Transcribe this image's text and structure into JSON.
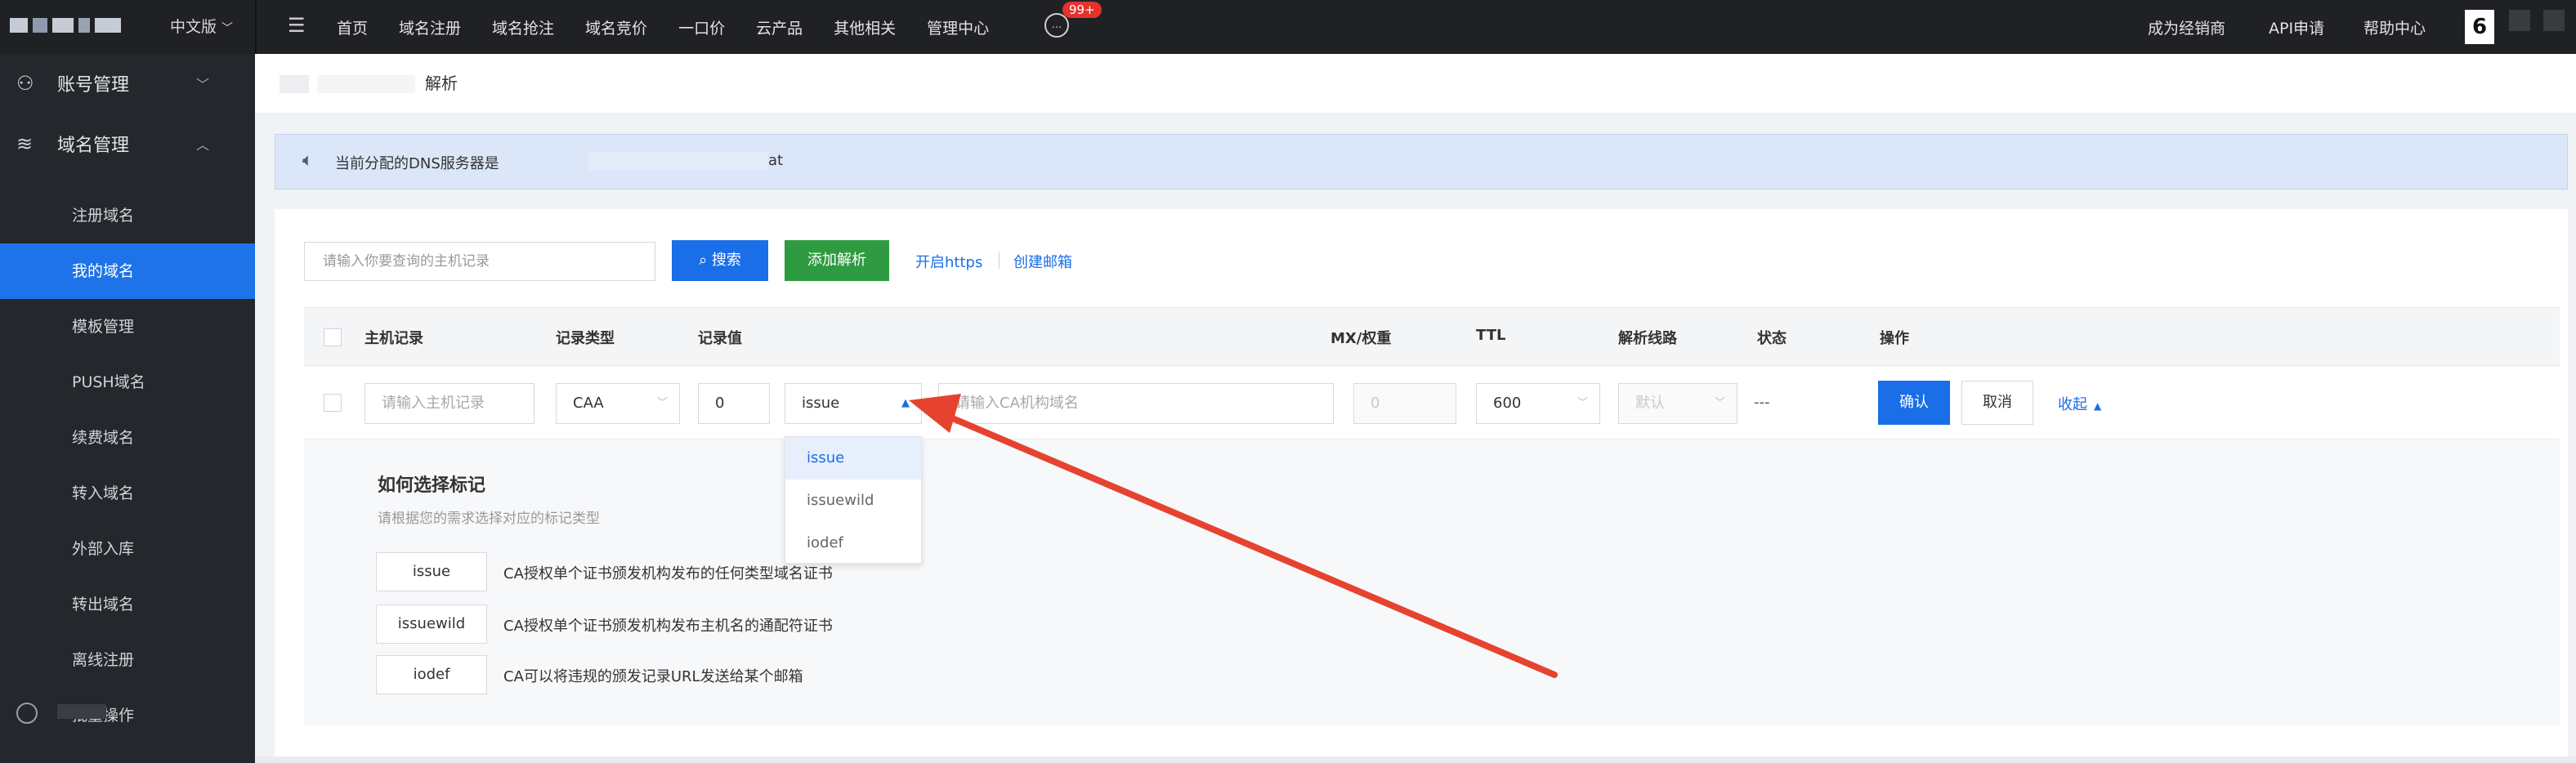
{
  "topbar": {
    "lang": "中文版",
    "nav": [
      "首页",
      "域名注册",
      "域名抢注",
      "域名竞价",
      "一口价",
      "云产品",
      "其他相关",
      "管理中心"
    ],
    "badge": "99+",
    "right_nav": [
      "成为经销商",
      "API申请",
      "帮助中心"
    ],
    "avatar_text": "6"
  },
  "sidebar": {
    "group_account": "账号管理",
    "group_domain": "域名管理",
    "items": [
      "注册域名",
      "我的域名",
      "模板管理",
      "PUSH域名",
      "续费域名",
      "转入域名",
      "外部入库",
      "转出域名",
      "离线注册",
      "批量操作"
    ],
    "active_index": 1
  },
  "breadcrumb": {
    "title": "解析"
  },
  "dns_notice": {
    "text": "当前分配的DNS服务器是",
    "tail": "at"
  },
  "toolbar": {
    "search_placeholder": "请输入你要查询的主机记录",
    "search_button": "搜索",
    "add_button": "添加解析",
    "link_https": "开启https",
    "link_email": "创建邮箱"
  },
  "table": {
    "headers": [
      "主机记录",
      "记录类型",
      "记录值",
      "MX/权重",
      "TTL",
      "解析线路",
      "状态",
      "操作"
    ],
    "row": {
      "host_placeholder": "请输入主机记录",
      "type": "CAA",
      "flag": "0",
      "tag": "issue",
      "value_placeholder": "请输入CA机构域名",
      "mx": "0",
      "ttl": "600",
      "line": "默认",
      "status": "---",
      "confirm": "确认",
      "cancel": "取消",
      "collapse": "收起"
    }
  },
  "tag_dropdown": {
    "options": [
      "issue",
      "issuewild",
      "iodef"
    ],
    "selected": "issue"
  },
  "help": {
    "title": "如何选择标记",
    "subtitle": "请根据您的需求选择对应的标记类型",
    "items": [
      {
        "tag": "issue",
        "desc": "CA授权单个证书颁发机构发布的任何类型域名证书"
      },
      {
        "tag": "issuewild",
        "desc": "CA授权单个证书颁发机构发布主机名的通配符证书"
      },
      {
        "tag": "iodef",
        "desc": "CA可以将违规的颁发记录URL发送给某个邮箱"
      }
    ]
  },
  "colors": {
    "primary": "#1a6ee8",
    "success": "#2f9b40",
    "annotation_arrow": "#e5432f",
    "topbar": "#202124",
    "sidebar": "#24272c"
  }
}
